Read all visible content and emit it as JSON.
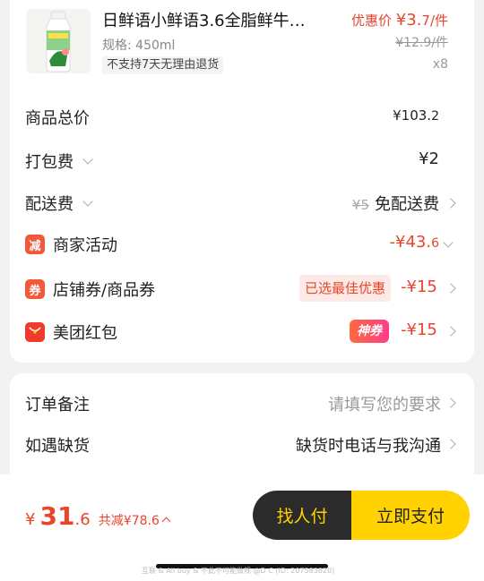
{
  "product": {
    "title": "日鲜语小鲜语3.6全脂鲜牛…",
    "promo_label": "优惠价",
    "promo_price": "¥3.",
    "promo_price_dec": "7",
    "promo_unit": "/件",
    "original_price": "¥12.9/件",
    "spec": "规格: 450ml",
    "return_policy": "不支持7天无理由退货",
    "quantity": "x8",
    "image_icon": "milk-bottle-icon"
  },
  "fees": {
    "total_label": "商品总价",
    "total_value": "¥103.",
    "total_value_dec": "2",
    "packing_label": "打包费",
    "packing_value": "¥2",
    "delivery_label": "配送费",
    "delivery_orig": "¥5",
    "delivery_value": "免配送费",
    "merchant_icon": "减",
    "merchant_label": "商家活动",
    "merchant_value": "-¥43.",
    "merchant_value_dec": "6",
    "coupon_icon": "券",
    "coupon_label": "店铺券/商品券",
    "coupon_tag": "已选最佳优惠",
    "coupon_value": "-¥15",
    "hongbao_label": "美团红包",
    "hongbao_tag": "神券",
    "hongbao_value": "-¥15"
  },
  "order": {
    "remark_label": "订单备注",
    "remark_placeholder": "请填写您的要求",
    "outofstock_label": "如遇缺货",
    "outofstock_value": "缺货时电话与我沟通"
  },
  "footer": {
    "currency": "¥",
    "total_int": "31",
    "total_dec": ".6",
    "discount_text": "共减¥78.6",
    "pay_for_me": "找人付",
    "pay_now": "立即支付",
    "watermark": "互联 & All buy & 不此不可能做规 @D C (ID: 207583820)"
  },
  "colors": {
    "accent_red": "#e8452c",
    "pay_yellow": "#ffd200",
    "dark": "#2b2b2b"
  }
}
